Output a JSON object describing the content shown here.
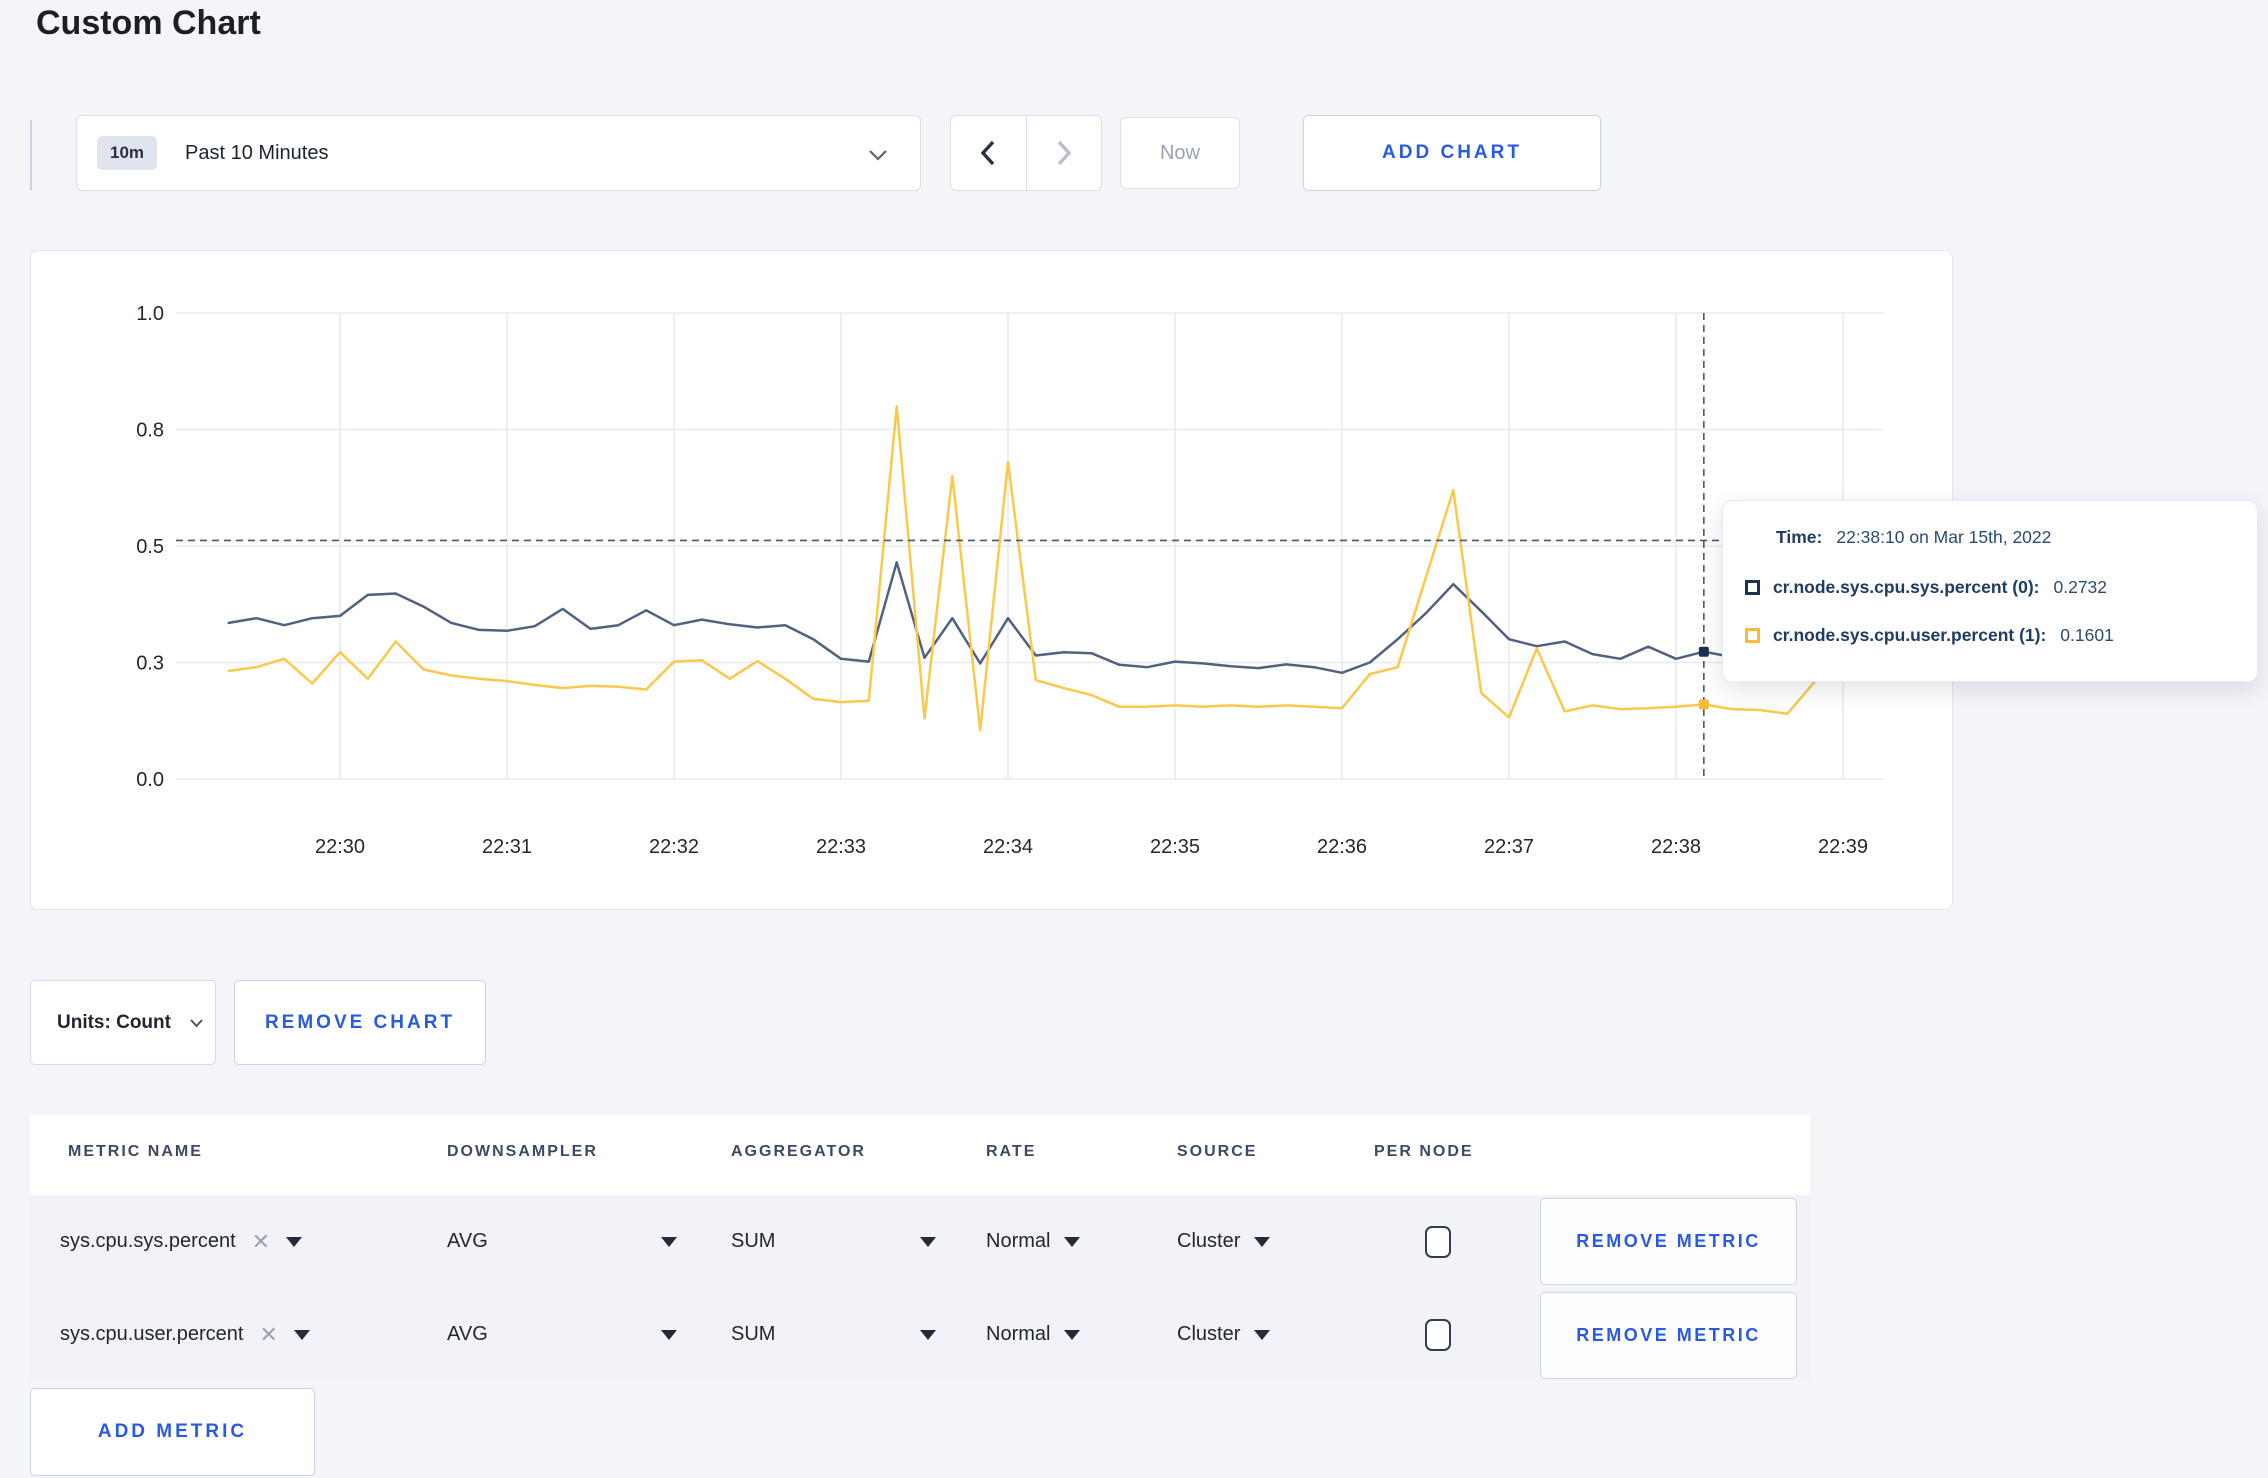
{
  "page": {
    "title": "Custom Chart"
  },
  "colors": {
    "accent_blue": "#2a5ae2",
    "page_background": "#f4f5f9",
    "gridline": "#e8ebf1",
    "crosshair": "#45596f",
    "tick_label": "#23272e"
  },
  "toolbar": {
    "time_badge": "10m",
    "time_label": "Past 10 Minutes",
    "prev_icon": "chevron-left",
    "next_icon": "chevron-right",
    "now_label": "Now",
    "add_chart_label": "ADD CHART"
  },
  "tooltip": {
    "time_label": "Time:",
    "time_value": "22:38:10 on Mar 15th, 2022",
    "series": [
      {
        "swatch_color": "#1f3150",
        "label": "cr.node.sys.cpu.sys.percent (0):",
        "value": "0.2732"
      },
      {
        "swatch_color": "#f8bb35",
        "label": "cr.node.sys.cpu.user.percent (1):",
        "value": "0.1601"
      }
    ]
  },
  "units_bar": {
    "units_label": "Units: Count",
    "remove_chart_label": "REMOVE CHART"
  },
  "metrics_table": {
    "headers": [
      "METRIC NAME",
      "DOWNSAMPLER",
      "AGGREGATOR",
      "RATE",
      "SOURCE",
      "PER NODE"
    ],
    "rows": [
      {
        "name": "sys.cpu.sys.percent",
        "downsampler": "AVG",
        "aggregator": "SUM",
        "rate": "Normal",
        "source": "Cluster",
        "per_node_checked": false,
        "remove_label": "REMOVE METRIC"
      },
      {
        "name": "sys.cpu.user.percent",
        "downsampler": "AVG",
        "aggregator": "SUM",
        "rate": "Normal",
        "source": "Cluster",
        "per_node_checked": false,
        "remove_label": "REMOVE METRIC"
      }
    ],
    "add_metric_label": "ADD METRIC"
  },
  "chart_data": {
    "type": "line",
    "title": "",
    "xlabel": "",
    "ylabel": "",
    "ylim": [
      0,
      1
    ],
    "grid": true,
    "legend": "none",
    "x_step_seconds": 10,
    "x": [
      "22:29:20",
      "22:29:30",
      "22:29:40",
      "22:29:50",
      "22:30:00",
      "22:30:10",
      "22:30:20",
      "22:30:30",
      "22:30:40",
      "22:30:50",
      "22:31:00",
      "22:31:10",
      "22:31:20",
      "22:31:30",
      "22:31:40",
      "22:31:50",
      "22:32:00",
      "22:32:10",
      "22:32:20",
      "22:32:30",
      "22:32:40",
      "22:32:50",
      "22:33:00",
      "22:33:10",
      "22:33:20",
      "22:33:30",
      "22:33:40",
      "22:33:50",
      "22:34:00",
      "22:34:10",
      "22:34:20",
      "22:34:30",
      "22:34:40",
      "22:34:50",
      "22:35:00",
      "22:35:10",
      "22:35:20",
      "22:35:30",
      "22:35:40",
      "22:35:50",
      "22:36:00",
      "22:36:10",
      "22:36:20",
      "22:36:30",
      "22:36:40",
      "22:36:50",
      "22:37:00",
      "22:37:10",
      "22:37:20",
      "22:37:30",
      "22:37:40",
      "22:37:50",
      "22:38:00",
      "22:38:10",
      "22:38:20",
      "22:38:30",
      "22:38:40",
      "22:38:50",
      "22:39:00",
      "22:39:10"
    ],
    "x_ticks": [
      "22:30",
      "22:31",
      "22:32",
      "22:33",
      "22:34",
      "22:35",
      "22:36",
      "22:37",
      "22:38",
      "22:39"
    ],
    "y_ticks": [
      {
        "value": 0,
        "label": "0.0"
      },
      {
        "value": 0.25,
        "label": "0.3"
      },
      {
        "value": 0.5,
        "label": "0.5"
      },
      {
        "value": 0.75,
        "label": "0.8"
      },
      {
        "value": 1,
        "label": "1.0"
      }
    ],
    "series": [
      {
        "name": "cr.node.sys.cpu.sys.percent (0)",
        "color": "#51627e",
        "marker_color": "#1f3150",
        "values": [
          0.335,
          0.345,
          0.33,
          0.345,
          0.35,
          0.395,
          0.398,
          0.37,
          0.335,
          0.32,
          0.318,
          0.328,
          0.365,
          0.322,
          0.33,
          0.362,
          0.33,
          0.342,
          0.332,
          0.325,
          0.33,
          0.3,
          0.258,
          0.252,
          0.465,
          0.26,
          0.345,
          0.248,
          0.345,
          0.265,
          0.272,
          0.27,
          0.245,
          0.24,
          0.252,
          0.248,
          0.242,
          0.238,
          0.246,
          0.24,
          0.228,
          0.25,
          0.3,
          0.355,
          0.418,
          0.36,
          0.3,
          0.285,
          0.295,
          0.268,
          0.258,
          0.284,
          0.258,
          0.2732,
          0.262,
          0.27,
          0.278,
          0.268,
          0.262,
          0.258
        ]
      },
      {
        "name": "cr.node.sys.cpu.user.percent (1)",
        "color": "#fbc84a",
        "marker_color": "#f8bb35",
        "values": [
          0.232,
          0.24,
          0.258,
          0.205,
          0.272,
          0.215,
          0.295,
          0.235,
          0.222,
          0.215,
          0.21,
          0.202,
          0.195,
          0.2,
          0.198,
          0.192,
          0.252,
          0.255,
          0.215,
          0.253,
          0.215,
          0.172,
          0.165,
          0.168,
          0.8,
          0.13,
          0.65,
          0.105,
          0.68,
          0.212,
          0.195,
          0.18,
          0.155,
          0.155,
          0.158,
          0.155,
          0.158,
          0.155,
          0.158,
          0.155,
          0.152,
          0.225,
          0.24,
          0.43,
          0.62,
          0.185,
          0.132,
          0.28,
          0.145,
          0.158,
          0.15,
          0.152,
          0.155,
          0.1601,
          0.15,
          0.148,
          0.14,
          0.21,
          0.262,
          0.235
        ]
      }
    ],
    "crosshair": {
      "time_full": "22:38:10",
      "y_value": 0.512,
      "values": [
        0.2732,
        0.1601
      ]
    }
  }
}
